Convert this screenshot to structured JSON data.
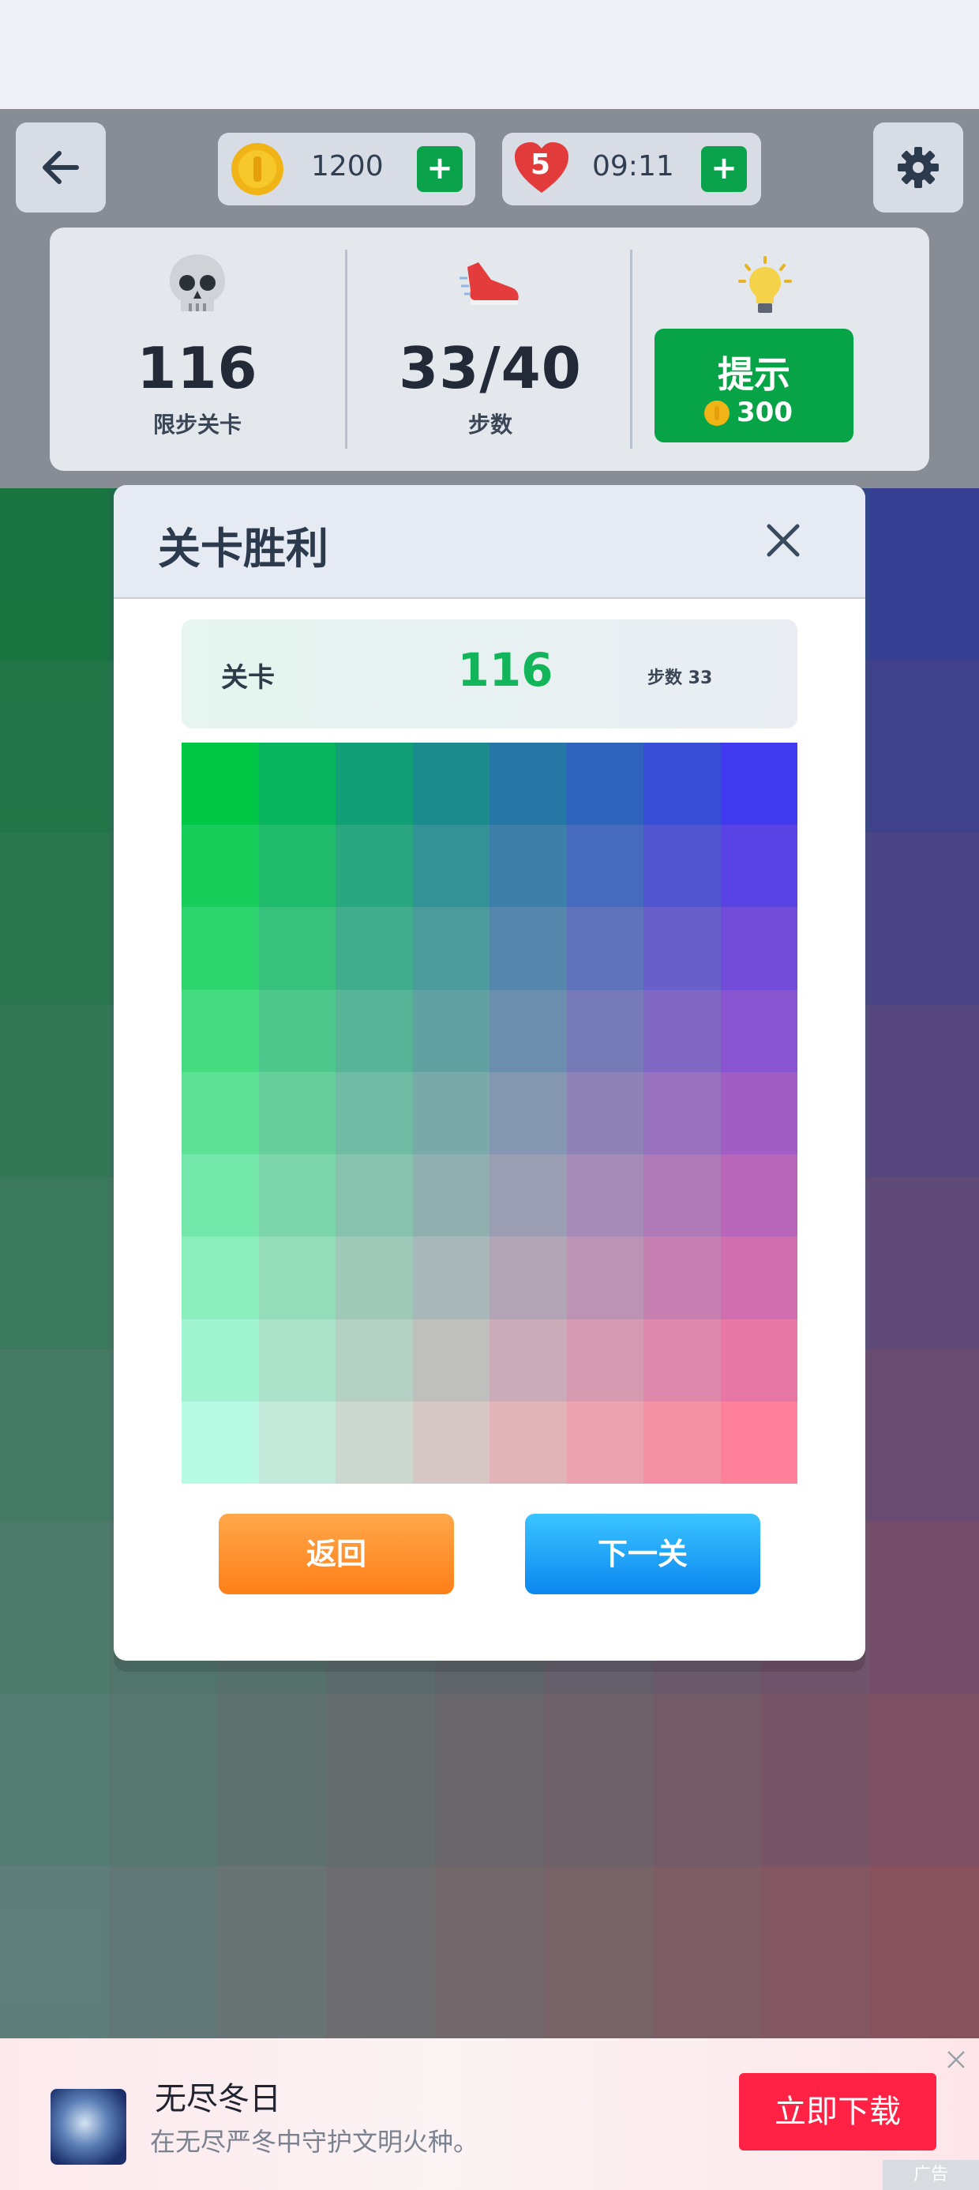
{
  "colors": {
    "accent_green": "#07a447",
    "level_green": "#12b55a",
    "back_orange": "#ff8a26",
    "next_blue": "#1a9af5",
    "ad_red": "#ff2244"
  },
  "topbar": {
    "back_icon": "back-arrow-icon",
    "coins": {
      "icon": "coin-icon",
      "value": "1200",
      "plus": "+"
    },
    "lives": {
      "icon": "heart-icon",
      "count": "5",
      "timer": "09:11",
      "plus": "+"
    },
    "settings_icon": "gear-icon"
  },
  "stats": {
    "level": {
      "icon": "skull-icon",
      "value": "116",
      "label": "限步关卡"
    },
    "steps": {
      "icon": "sneaker-icon",
      "value": "33/40",
      "label": "步数"
    },
    "hint": {
      "icon": "lightbulb-icon",
      "label": "提示",
      "cost": "300"
    }
  },
  "dialog": {
    "title": "关卡胜利",
    "close_icon": "close-icon",
    "info": {
      "label": "关卡",
      "level": "116",
      "steps": "步数 33"
    },
    "back_label": "返回",
    "next_label": "下一关"
  },
  "ad": {
    "title": "无尽冬日",
    "subtitle": "在无尽严冬中守护文明火种。",
    "cta": "立即下载",
    "tag": "广告"
  }
}
